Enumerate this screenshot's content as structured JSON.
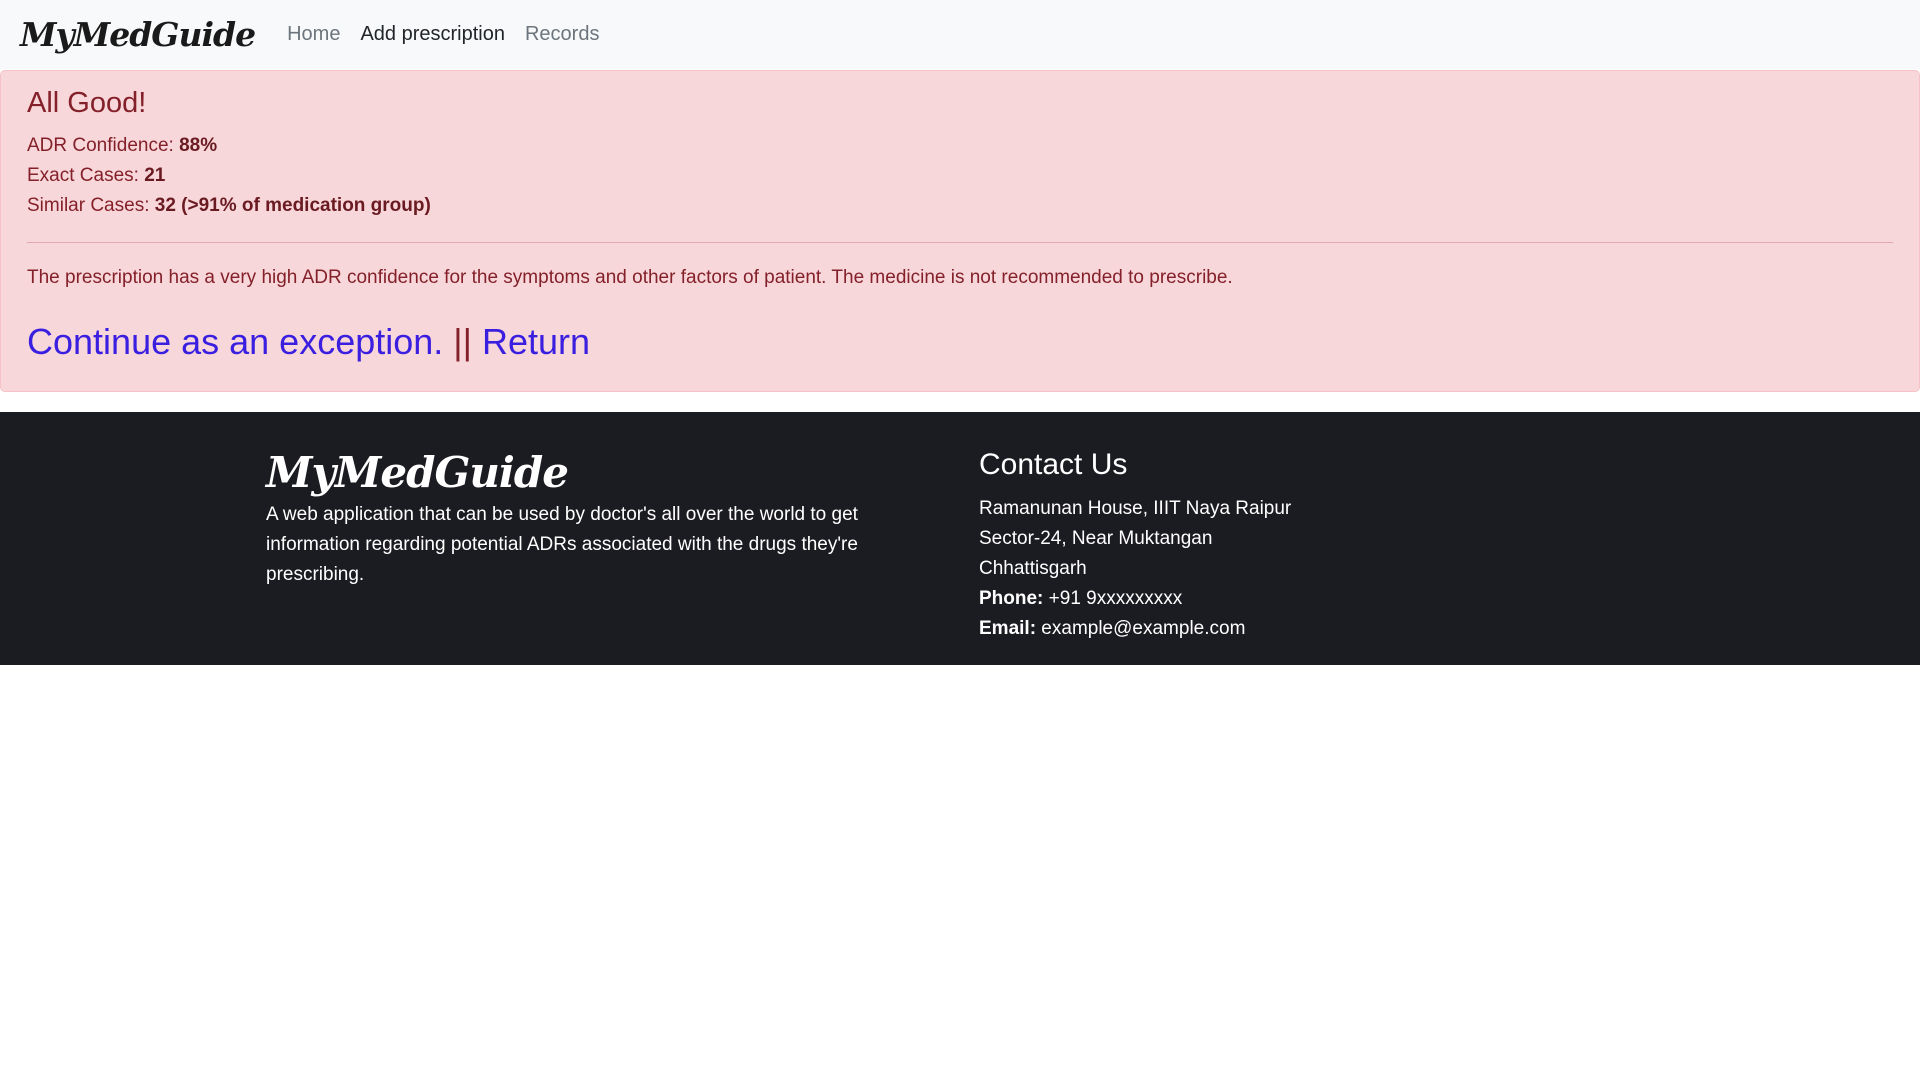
{
  "navbar": {
    "brand": "MyMedGuide",
    "links": [
      {
        "label": "Home",
        "active": false
      },
      {
        "label": "Add prescription",
        "active": true
      },
      {
        "label": "Records",
        "active": false
      }
    ]
  },
  "alert": {
    "heading": "All Good!",
    "adr_label": "ADR Confidence: ",
    "adr_value": "88%",
    "exact_label": "Exact Cases: ",
    "exact_value": "21",
    "similar_label": "Similar Cases: ",
    "similar_value": "32 (>91% of medication group)",
    "message": "The prescription has a very high ADR confidence for the symptoms and other factors of patient. The medicine is not recommended to prescribe.",
    "continue_label": "Continue as an exception.",
    "separator": " || ",
    "return_label": "Return"
  },
  "footer": {
    "brand": "MyMedGuide",
    "description": "A web application that can be used by doctor's all over the world to get information regarding potential ADRs associated with the drugs they're prescribing.",
    "contact_title": "Contact Us",
    "address_line1": "Ramanunan House, IIIT Naya Raipur",
    "address_line2": "Sector-24, Near Muktangan",
    "address_line3": "Chhattisgarh",
    "phone_label": "Phone:",
    "phone_value": " +91 9xxxxxxxxx",
    "email_label": "Email:",
    "email_value": " example@example.com"
  },
  "colors": {
    "navbar_bg": "#f8f9fa",
    "alert_bg": "#f8d7da",
    "alert_text": "#842029",
    "link": "#3a1fe0",
    "footer_bg": "#1b1b22"
  }
}
